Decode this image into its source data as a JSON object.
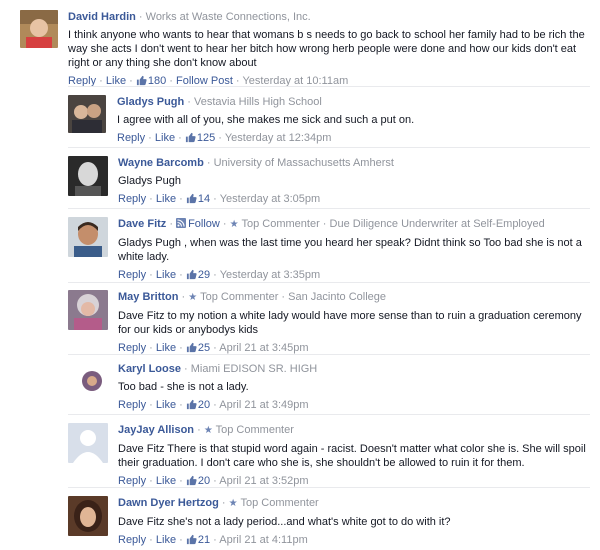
{
  "comments": [
    {
      "name": "David Hardin",
      "meta": " · Works at Waste Connections, Inc.",
      "text": "I think anyone who wants to hear that womans b s needs to go back to school her family had to be rich the way she acts I don't went to hear her bitch how wrong herb people were done and how our kids don't eat right or any thing she don't know about",
      "reply": "Reply",
      "like": "Like",
      "likes": "180",
      "follow": "Follow Post",
      "time": "Yesterday at 10:11am"
    },
    {
      "name": "Gladys Pugh",
      "meta": " · Vestavia Hills High School",
      "text": "I agree with all of you, she makes me sick and such a put on.",
      "reply": "Reply",
      "like": "Like",
      "likes": "125",
      "time": "Yesterday at 12:34pm"
    },
    {
      "name": "Wayne Barcomb",
      "meta": " · University of Massachusetts Amherst",
      "text": "Gladys Pugh",
      "reply": "Reply",
      "like": "Like",
      "likes": "14",
      "time": "Yesterday at 3:05pm"
    },
    {
      "name": "Dave Fitz",
      "follow": "Follow",
      "badge": "Top Commenter",
      "meta": " · Due Diligence Underwriter at Self-Employed",
      "text": "Gladys Pugh , when was the last time you heard her speak? Didnt think so Too bad she is not a white lady.",
      "reply": "Reply",
      "like": "Like",
      "likes": "29",
      "time": "Yesterday at 3:35pm"
    },
    {
      "name": "May Britton",
      "badge": "Top Commenter",
      "meta": " · San Jacinto College",
      "text": "Dave Fitz to my notion a white lady would have more sense than to ruin a graduation ceremony for our kids or anybodys kids",
      "reply": "Reply",
      "like": "Like",
      "likes": "25",
      "time": "April 21 at 3:45pm"
    },
    {
      "name": "Karyl Loose",
      "meta": " · Miami EDISON SR. HIGH",
      "text": "Too bad - she is not a lady.",
      "reply": "Reply",
      "like": "Like",
      "likes": "20",
      "time": "April 21 at 3:49pm"
    },
    {
      "name": "JayJay Allison",
      "badge": "Top Commenter",
      "text": "Dave Fitz There is that stupid word again - racist. Doesn't matter what color she is. She will spoil their graduation. I don't care who she is, she shouldn't be allowed to ruin it for them.",
      "reply": "Reply",
      "like": "Like",
      "likes": "20",
      "time": "April 21 at 3:52pm"
    },
    {
      "name": "Dawn Dyer Hertzog",
      "badge": "Top Commenter",
      "text": "Dave Fitz she's not a lady period...and what's white got to do with it?",
      "reply": "Reply",
      "like": "Like",
      "likes": "21",
      "time": "April 21 at 4:11pm"
    }
  ],
  "icons": {
    "like": "thumbs-up-icon",
    "follow": "rss-icon",
    "top_commenter": "star-icon",
    "accent": "#3b5998",
    "meta_color": "#90949c"
  }
}
